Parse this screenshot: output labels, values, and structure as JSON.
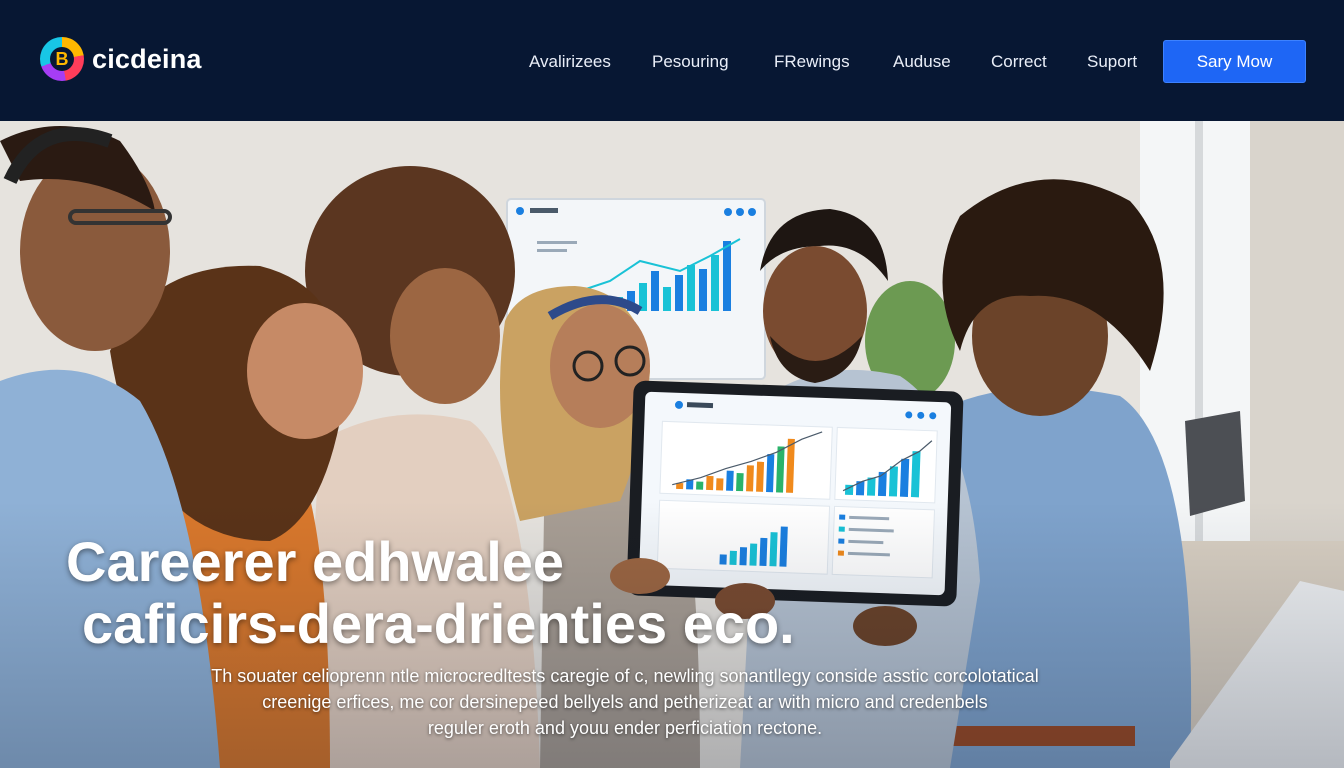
{
  "brand": {
    "name": "cicdeina",
    "logo_glyph": "B"
  },
  "nav": {
    "items": [
      "Avalirizees",
      "Pesouring",
      "FRewings",
      "Auduse",
      "Correct",
      "Suport"
    ],
    "cta_label": "Sary Mow"
  },
  "hero": {
    "headline_line1": "Careerer edhwalee",
    "headline_line2": "caficirs-dera-drienties eco.",
    "sub_lines": [
      "Th souater celioprenn ntle microcredltests caregie of c, newling sonantllegy conside asstic corcolotatical",
      "creenige erfices, me cor dersinepeed bellyels and petherizeat ar with micro and credenbels",
      "reguler eroth and youu ender perficiation rectone."
    ]
  },
  "colors": {
    "nav_bg": "#071733",
    "cta_bg": "#1e66f5",
    "chart_blue": "#1a7fe0",
    "chart_teal": "#19c2d6",
    "chart_orange": "#f08a1c",
    "chart_green": "#2ab36a"
  }
}
